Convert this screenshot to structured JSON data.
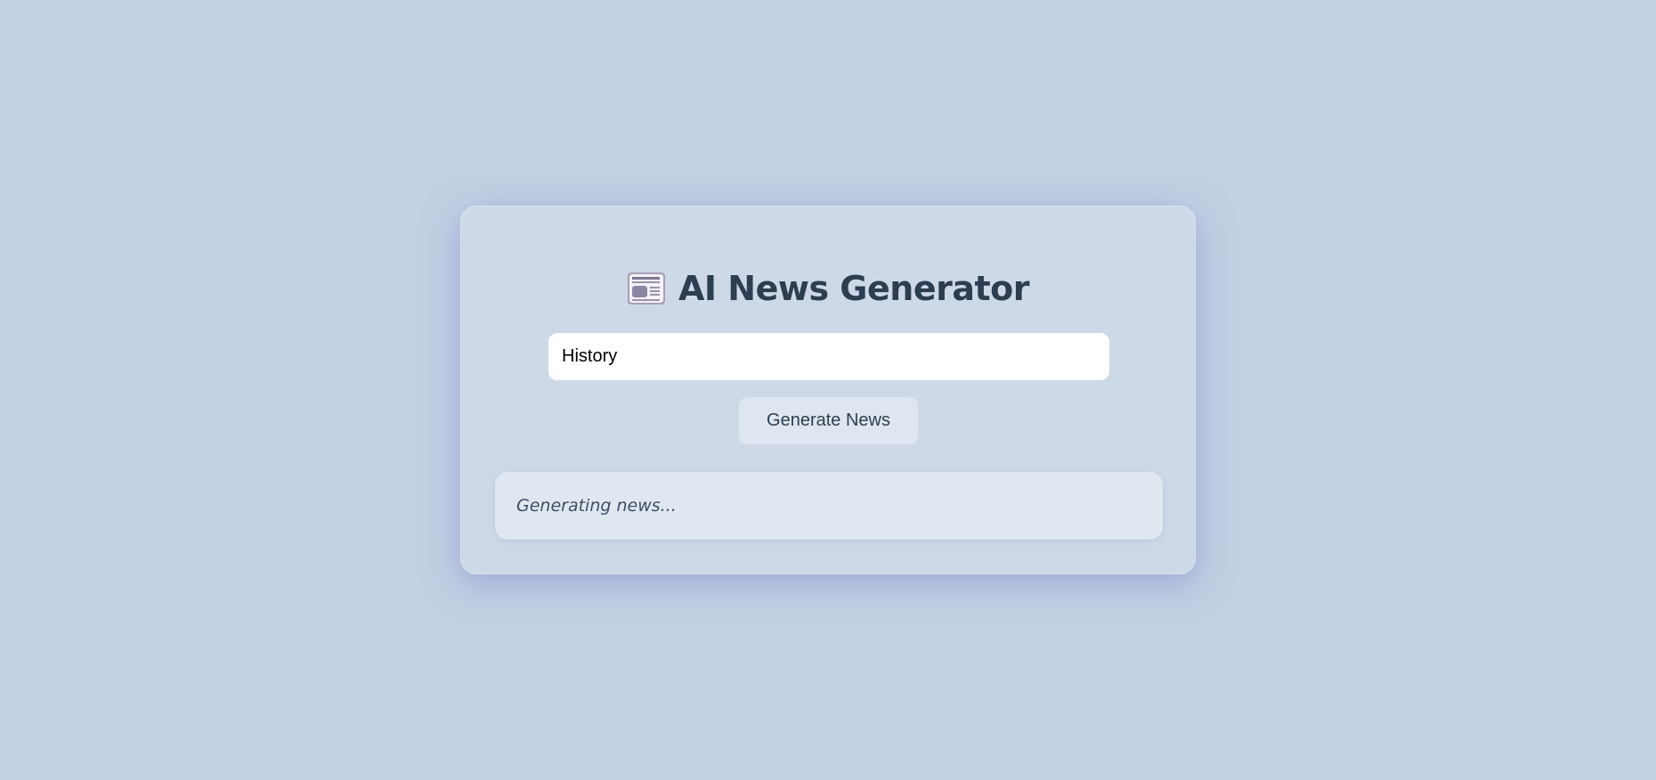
{
  "header": {
    "icon": "newspaper-icon",
    "title": "AI News Generator"
  },
  "form": {
    "topic_value": "History",
    "generate_label": "Generate News"
  },
  "output": {
    "status": "Generating news..."
  },
  "colors": {
    "background": "#c3d0e3",
    "card": "#ced9e8",
    "title_text": "#2c3e50",
    "button_bg": "#dfe6f0",
    "output_bg": "#e0e7f1"
  }
}
